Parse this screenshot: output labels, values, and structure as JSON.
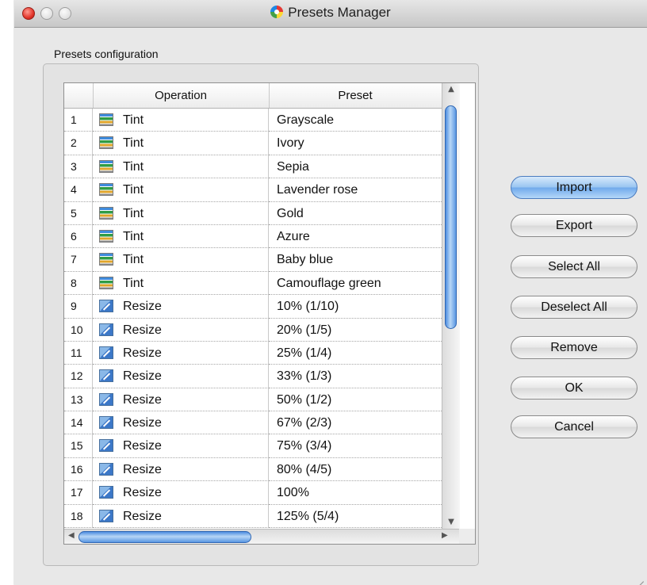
{
  "window": {
    "title": "Presets Manager",
    "icons": {
      "close": "close-icon",
      "minimize": "minimize-icon",
      "zoom": "zoom-icon",
      "app": "app-icon"
    }
  },
  "group": {
    "label": "Presets configuration"
  },
  "table": {
    "columns": {
      "number": "",
      "operation": "Operation",
      "preset": "Preset"
    },
    "rows": [
      {
        "n": "1",
        "operation": "Tint",
        "icon": "tint-icon",
        "preset": "Grayscale"
      },
      {
        "n": "2",
        "operation": "Tint",
        "icon": "tint-icon",
        "preset": "Ivory"
      },
      {
        "n": "3",
        "operation": "Tint",
        "icon": "tint-icon",
        "preset": "Sepia"
      },
      {
        "n": "4",
        "operation": "Tint",
        "icon": "tint-icon",
        "preset": "Lavender rose"
      },
      {
        "n": "5",
        "operation": "Tint",
        "icon": "tint-icon",
        "preset": "Gold"
      },
      {
        "n": "6",
        "operation": "Tint",
        "icon": "tint-icon",
        "preset": "Azure"
      },
      {
        "n": "7",
        "operation": "Tint",
        "icon": "tint-icon",
        "preset": "Baby blue"
      },
      {
        "n": "8",
        "operation": "Tint",
        "icon": "tint-icon",
        "preset": "Camouflage green"
      },
      {
        "n": "9",
        "operation": "Resize",
        "icon": "resize-icon",
        "preset": "10% (1/10)"
      },
      {
        "n": "10",
        "operation": "Resize",
        "icon": "resize-icon",
        "preset": "20% (1/5)"
      },
      {
        "n": "11",
        "operation": "Resize",
        "icon": "resize-icon",
        "preset": "25% (1/4)"
      },
      {
        "n": "12",
        "operation": "Resize",
        "icon": "resize-icon",
        "preset": "33% (1/3)"
      },
      {
        "n": "13",
        "operation": "Resize",
        "icon": "resize-icon",
        "preset": "50% (1/2)"
      },
      {
        "n": "14",
        "operation": "Resize",
        "icon": "resize-icon",
        "preset": "67% (2/3)"
      },
      {
        "n": "15",
        "operation": "Resize",
        "icon": "resize-icon",
        "preset": "75% (3/4)"
      },
      {
        "n": "16",
        "operation": "Resize",
        "icon": "resize-icon",
        "preset": "80% (4/5)"
      },
      {
        "n": "17",
        "operation": "Resize",
        "icon": "resize-icon",
        "preset": "100%"
      },
      {
        "n": "18",
        "operation": "Resize",
        "icon": "resize-icon",
        "preset": "125% (5/4)"
      }
    ]
  },
  "buttons": {
    "import": "Import",
    "export": "Export",
    "select_all": "Select All",
    "deselect_all": "Deselect All",
    "remove": "Remove",
    "ok": "OK",
    "cancel": "Cancel"
  },
  "colors": {
    "default_button": "#98c4f1",
    "scroll_thumb": "#4d8de0",
    "window_bg": "#e8e8e8"
  }
}
